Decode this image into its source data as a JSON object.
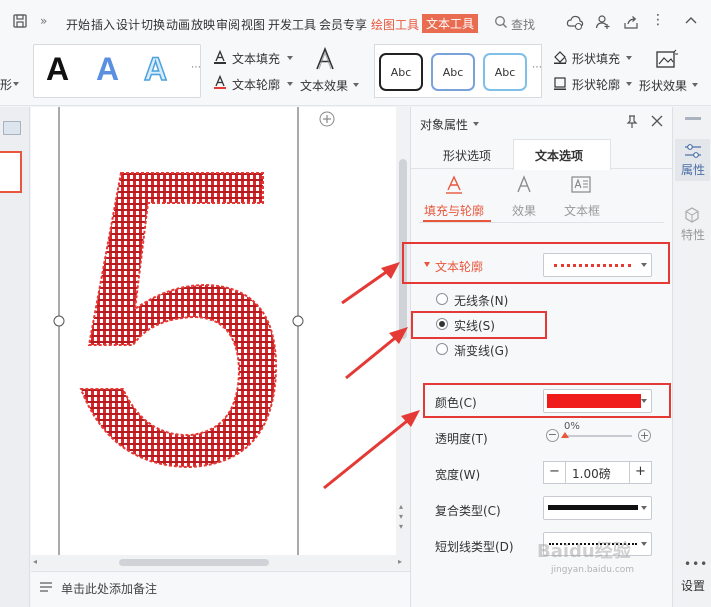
{
  "menubar": {
    "items": [
      "开始",
      "插入",
      "设计",
      "切换",
      "动画",
      "放映",
      "审阅",
      "视图",
      "开发工具",
      "会员专享",
      "绘图工具",
      "文本工具"
    ],
    "search_label": "查找"
  },
  "ribbon": {
    "art_letters": [
      "A",
      "A",
      "A"
    ],
    "text_fill": "文本填充",
    "text_outline": "文本轮廓",
    "text_effect": "文本效果",
    "shape_style_samples": [
      "Abc",
      "Abc",
      "Abc"
    ],
    "shape_fill": "形状填充",
    "shape_outline": "形状轮廓",
    "shape_effect": "形状效果",
    "left_cut_label": "形"
  },
  "slide": {
    "big_character": "5",
    "outline_color": "#e53935"
  },
  "notes": {
    "placeholder": "单击此处添加备注"
  },
  "panel": {
    "title": "对象属性",
    "tabs": [
      "形状选项",
      "文本选项"
    ],
    "active_tab": "文本选项",
    "subtabs": [
      "填充与轮廓",
      "效果",
      "文本框"
    ],
    "section_title": "文本轮廓",
    "line_options": [
      {
        "label": "无线条(N)",
        "selected": false
      },
      {
        "label": "实线(S)",
        "selected": true
      },
      {
        "label": "渐变线(G)",
        "selected": false
      }
    ],
    "color_label": "颜色(C)",
    "color_value": "#f01c1c",
    "transparency_label": "透明度(T)",
    "transparency_value": "0%",
    "width_label": "宽度(W)",
    "width_value": "1.00磅",
    "compound_label": "复合类型(C)",
    "dash_label": "短划线类型(D)"
  },
  "rightrail": {
    "properties": "属性",
    "features": "特性",
    "settings": "设置"
  },
  "watermark": {
    "line1": "Baidu经验",
    "line2": "jingyan.baidu.com"
  }
}
